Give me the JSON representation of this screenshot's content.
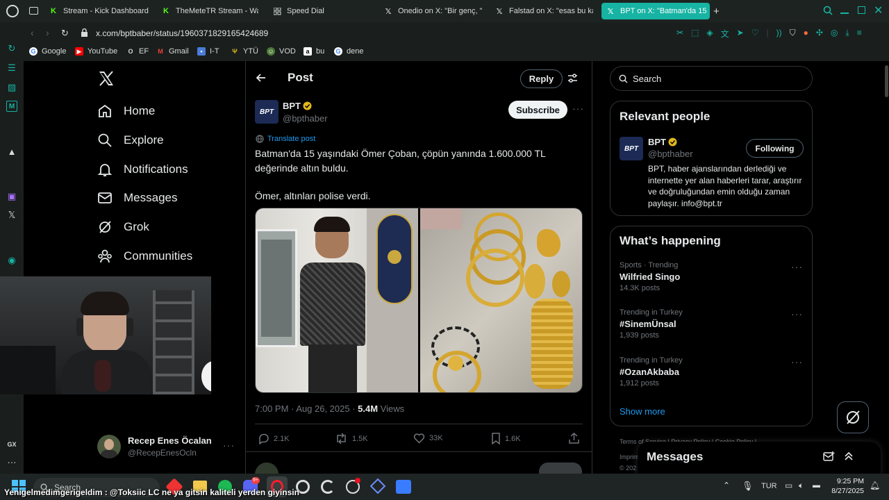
{
  "browser": {
    "tabs": [
      {
        "label": "Stream - Kick Dashboard",
        "icon": "kick-icon"
      },
      {
        "label": "TheMeteTR Stream - Wat",
        "icon": "kick-icon"
      },
      {
        "label": "Speed Dial",
        "icon": "grid-icon"
      },
      {
        "label": "Onedio on X: \"Bir genç, \"|",
        "icon": "x-icon"
      },
      {
        "label": "Falstad on X: \"esas bu ka",
        "icon": "x-icon"
      },
      {
        "label": "BPT on X: \"Batman'da 15",
        "icon": "x-icon"
      }
    ],
    "url": "x.com/bptbaber/status/1960371829165424689",
    "bookmarks": [
      "Google",
      "YouTube",
      "EF",
      "Gmail",
      "I-T",
      "YTÜ",
      "VOD",
      "bu",
      "dene"
    ]
  },
  "nav": {
    "items": [
      "Home",
      "Explore",
      "Notifications",
      "Messages",
      "Grok",
      "Communities"
    ],
    "account_name": "Recep Enes Öcalan",
    "account_handle": "@RecepEnesOcln"
  },
  "post": {
    "header_title": "Post",
    "reply_label": "Reply",
    "author_name": "BPT",
    "author_handle": "@bpthaber",
    "avatar_text": "BPT",
    "subscribe_label": "Subscribe",
    "translate_label": "Translate post",
    "text_line1": "Batman'da 15 yaşındaki Ömer Çoban, çöpün yanında 1.600.000 TL",
    "text_line2": "değerinde altın buldu.",
    "text_line3": "Ömer, altınları polise verdi.",
    "timestamp": "7:00 PM · Aug 26, 2025 · ",
    "views_count": "5.4M",
    "views_label": " Views",
    "replies": "2.1K",
    "reposts": "1.5K",
    "likes": "33K",
    "bookmarks": "1.6K"
  },
  "sidebar": {
    "search_placeholder": "Search",
    "relevant_title": "Relevant people",
    "person_name": "BPT",
    "person_handle": "@bpthaber",
    "following_label": "Following",
    "person_bio": "BPT, haber ajanslarından derlediği ve internette yer alan haberleri tarar, araştırır ve doğruluğundan emin olduğu zaman paylaşır. info@bpt.tr",
    "happening_title": "What’s happening",
    "trends": [
      {
        "category": "Sports · Trending",
        "name": "Wilfried Singo",
        "posts": "14.3K posts"
      },
      {
        "category": "Trending in Turkey",
        "name": "#SinemÜnsal",
        "posts": "1,939 posts"
      },
      {
        "category": "Trending in Turkey",
        "name": "#OzanAkbaba",
        "posts": "1,912 posts"
      }
    ],
    "show_more": "Show more",
    "footer_links": "Terms of Service  |  Privacy Policy  |  Cookie Policy  |",
    "footer_line2": "Imprint",
    "footer_line3": "© 202"
  },
  "messages_drawer": {
    "title": "Messages"
  },
  "taskbar": {
    "search_label": "Search",
    "ticker": "Yenigelmedimgerigeldim : @Toksiic LC ne ya gitsin kaliteli yerden giyinsin",
    "lang": "TUR",
    "time": "9:25 PM",
    "date": "8/27/2025"
  },
  "colors": {
    "accent": "#1d9bf0",
    "browser_accent": "#17b3a3",
    "verified": "#e2b719"
  }
}
